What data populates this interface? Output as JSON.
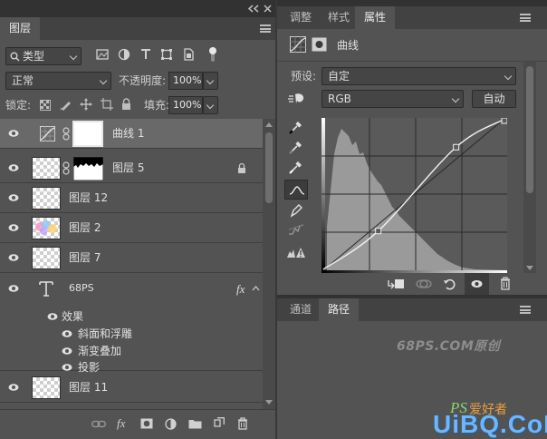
{
  "layers_panel": {
    "tab": "图层",
    "filter": {
      "value": "类型"
    },
    "blend_mode": "正常",
    "opacity_label": "不透明度:",
    "opacity_value": "100%",
    "lock_label": "锁定:",
    "fill_label": "填充:",
    "fill_value": "100%",
    "layers": [
      {
        "name": "曲线 1",
        "type": "adjustment-curves",
        "selected": true,
        "visible": true
      },
      {
        "name": "图层 5",
        "type": "masked",
        "visible": true,
        "locked": true
      },
      {
        "name": "图层 12",
        "visible": true
      },
      {
        "name": "图层 2",
        "visible": true
      },
      {
        "name": "图层 7",
        "visible": true
      },
      {
        "name": "68PS",
        "type": "text",
        "visible": true,
        "fx": "fx"
      },
      {
        "name": "效果",
        "type": "effects-header"
      },
      {
        "name": "斜面和浮雕",
        "type": "effect"
      },
      {
        "name": "渐变叠加",
        "type": "effect"
      },
      {
        "name": "投影",
        "type": "effect"
      },
      {
        "name": "图层 11",
        "visible": true
      }
    ]
  },
  "properties_panel": {
    "tabs": [
      "调整",
      "样式",
      "属性"
    ],
    "active_tab": "属性",
    "title": "曲线",
    "preset_label": "预设:",
    "preset_value": "自定",
    "channel_value": "RGB",
    "auto_button": "自动",
    "curve": {
      "points": [
        [
          0,
          0
        ],
        [
          77,
          65
        ],
        [
          186,
          207
        ],
        [
          255,
          255
        ]
      ],
      "note_scale": "input/output 0-255"
    }
  },
  "paths_panel": {
    "tabs": [
      "通道",
      "路径"
    ],
    "active_tab": "路径"
  },
  "watermarks": {
    "center": "68PS.COM原创",
    "ps_mark": "PS",
    "ps_cn": "爱好者",
    "site": "UiBQ.CoM"
  },
  "colors": {
    "panel_bg": "#535353",
    "tabbar_bg": "#424242",
    "selected_layer": "#696969",
    "frame": "#323232",
    "watermark_blue": "#6ab7ff",
    "watermark_green": "#8ad66a"
  }
}
